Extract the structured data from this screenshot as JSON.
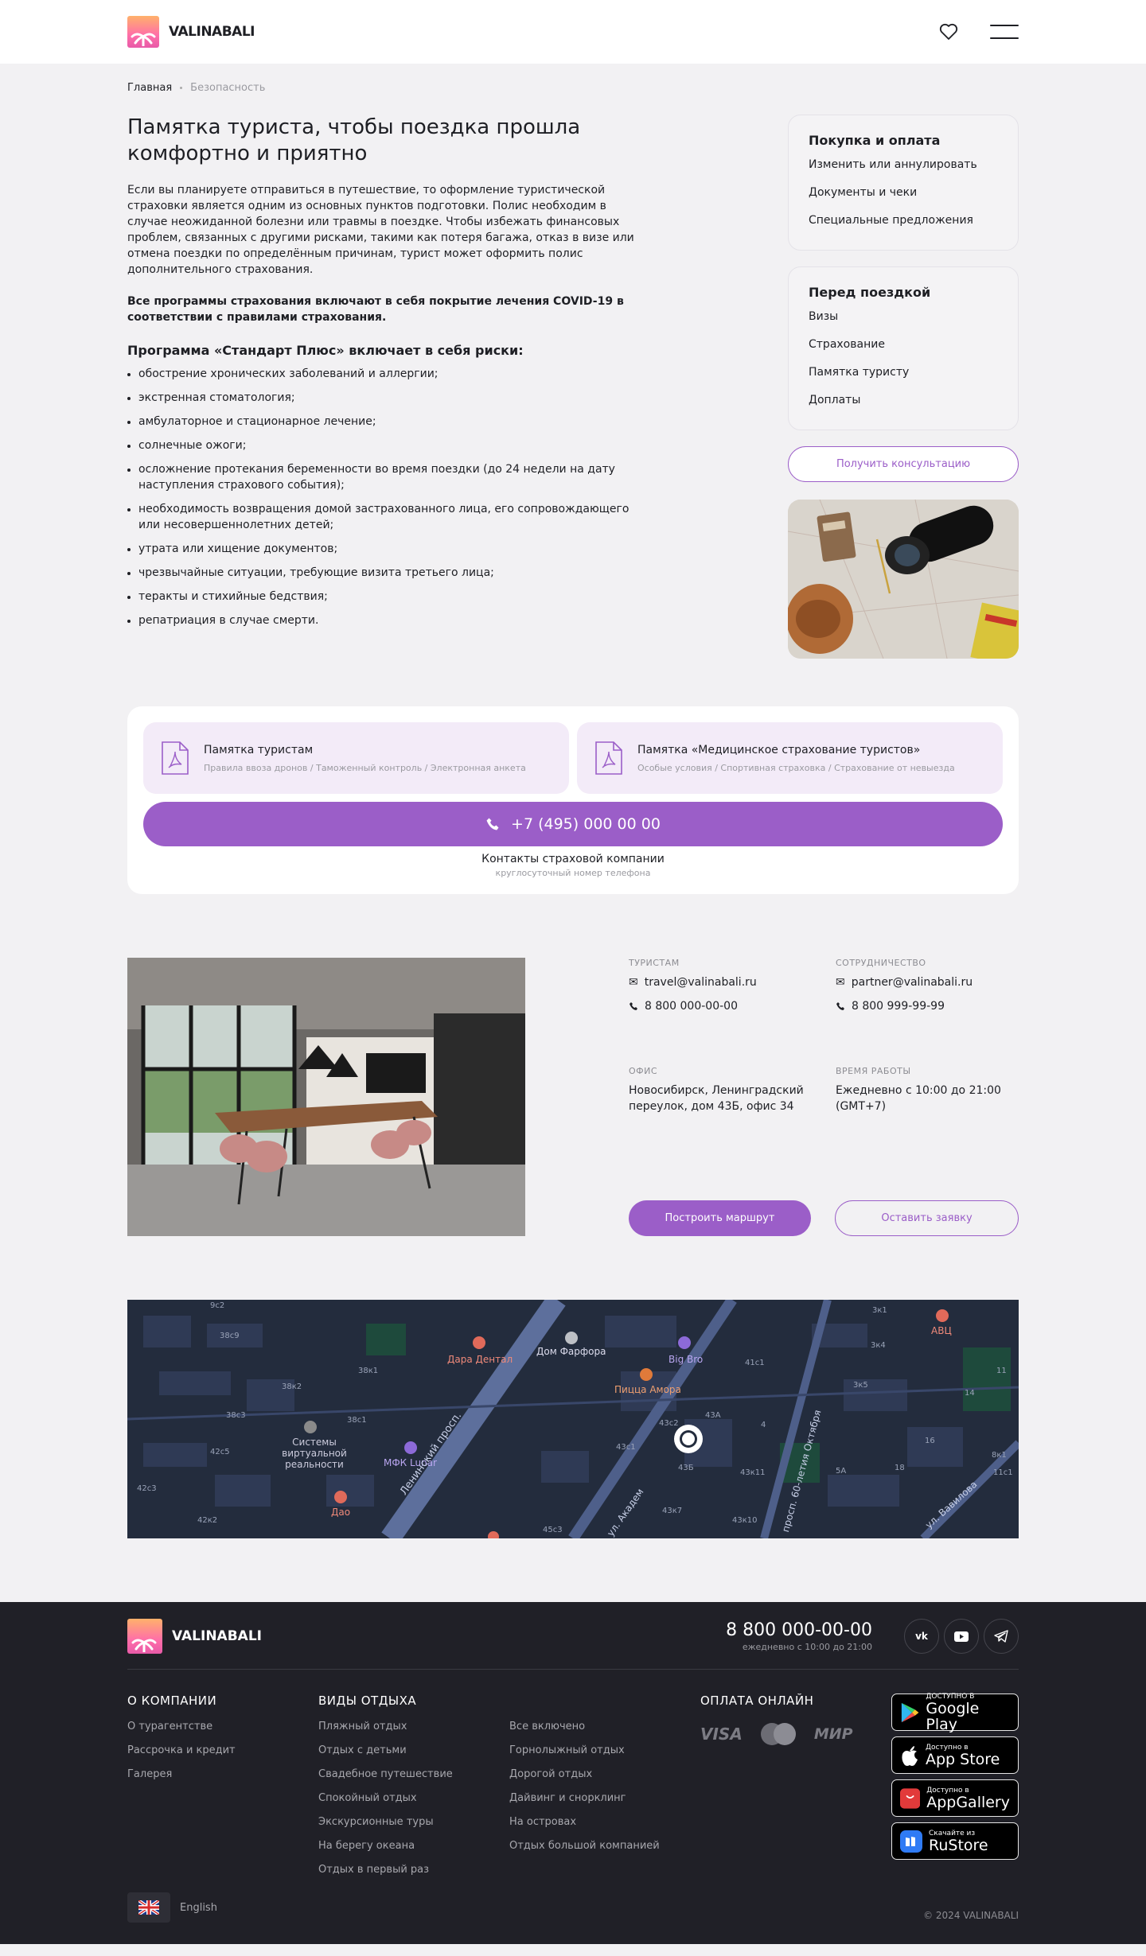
{
  "brand": {
    "name": "VALINABALI"
  },
  "breadcrumbs": [
    "Главная",
    "Безопасность"
  ],
  "article": {
    "title": "Памятка туриста, чтобы поездка прошла комфортно и приятно",
    "intro": "Если вы планируете отправиться в путешествие, то оформление туристической страховки является одним из основных пунктов подготовки. Полис необходим в случае неожиданной болезни или травмы в поездке. Чтобы избежать финансовых проблем, связанных с другими рисками, такими как потеря багажа, отказ в визе или отмена поездки по определённым причинам, турист может оформить полис дополнительного страхования.",
    "covid_note": "Все программы страхования включают в себя покрытие лечения COVID-19 в соответствии с правилами страхования.",
    "program_title": "Программа «Стандарт Плюс» включает в себя риски:",
    "risks": [
      "обострение хронических заболеваний и аллергии;",
      "экстренная стоматология;",
      "амбулаторное и стационарное лечение;",
      "солнечные ожоги;",
      "осложнение протекания беременности во время поездки (до 24 недели на дату наступления страхового события);",
      "необходимость возвращения домой застрахованного лица, его сопровождающего или несовершеннолетних детей;",
      "утрата или хищение документов;",
      "чрезвычайные ситуации, требующие визита третьего лица;",
      "теракты и стихийные бедствия;",
      "репатриация в случае смерти."
    ]
  },
  "sidebar": {
    "purchase": {
      "title": "Покупка и оплата",
      "items": [
        "Изменить или аннулировать",
        "Документы и чеки",
        "Специальные предложения"
      ]
    },
    "before_trip": {
      "title": "Перед поездкой",
      "items": [
        "Визы",
        "Страхование",
        "Памятка туристу",
        "Доплаты"
      ]
    },
    "consult_button": "Получить консультацию"
  },
  "docs": {
    "items": [
      {
        "title": "Памятка туристам",
        "subtitle": "Правила ввоза дронов / Таможенный контроль / Электронная анкета"
      },
      {
        "title": "Памятка «Медицинское страхование туристов»",
        "subtitle": "Особые условия / Спортивная страховка / Страхование от невыезда"
      }
    ],
    "phone": "+7 (495) 000 00 00",
    "contact_title": "Контакты страховой компании",
    "contact_sub": "круглосуточный номер телефона"
  },
  "contacts": {
    "tourists": {
      "label": "ТУРИСТАМ",
      "email": "travel@valinabali.ru",
      "phone": "8 800 000-00-00"
    },
    "partners": {
      "label": "СОТРУДНИЧЕСТВО",
      "email": "partner@valinabali.ru",
      "phone": "8 800 999-99-99"
    },
    "office": {
      "label": "ОФИС",
      "address": "Новосибирск, Ленинградский переулок, дом 43Б, офис 34"
    },
    "hours": {
      "label": "ВРЕМЯ РАБОТЫ",
      "value": "Ежедневно с 10:00 до 21:00 (GMT+7)"
    },
    "route_button": "Построить маршрут",
    "request_button": "Оставить заявку"
  },
  "map": {
    "labels": [
      "Дара Дентал",
      "Дом Фарфора",
      "Big Bro",
      "АВЦ",
      "Пицца Амора",
      "Системы виртуальной реальности",
      "МФК Lunar",
      "Дао",
      "Ленинский просп.",
      "ул. Академ",
      "просп. 60-летия Октября",
      "ул. Вавилова"
    ],
    "house_numbers": [
      "9с2",
      "38с9",
      "38к1",
      "38к2",
      "38с3",
      "38с1",
      "42с5",
      "42с3",
      "42к2",
      "45с3",
      "43с2",
      "43А",
      "43с1",
      "43Б",
      "43к7",
      "43к10",
      "43к11",
      "41с1",
      "3к1",
      "3к4",
      "3к5",
      "11",
      "14",
      "16",
      "18",
      "5А",
      "4",
      "8к1",
      "11с1"
    ]
  },
  "footer": {
    "phone": "8 800 000-00-00",
    "phone_hours": "ежедневно с 10:00 до 21:00",
    "about": {
      "title": "О КОМПАНИИ",
      "links": [
        "О турагентстве",
        "Рассрочка и кредит",
        "Галерея"
      ]
    },
    "rest": {
      "title": "ВИДЫ ОТДЫХА",
      "links_left": [
        "Пляжный отдых",
        "Отдых с детьми",
        "Свадебное путешествие",
        "Спокойный отдых",
        "Экскурсионные туры",
        "На берегу океана",
        "Отдых в первый раз"
      ],
      "links_right": [
        "Все включено",
        "Горнолыжный отдых",
        "Дорогой отдых",
        "Дайвинг и снорклинг",
        "На островах",
        "Отдых большой компанией"
      ]
    },
    "payment": {
      "title": "ОПЛАТА ОНЛАЙН",
      "methods": [
        "VISA",
        "МИР"
      ]
    },
    "stores": [
      {
        "small": "ДОСТУПНО В",
        "big": "Google Play"
      },
      {
        "small": "Доступно в",
        "big": "App Store"
      },
      {
        "small": "Доступно в",
        "big": "AppGallery"
      },
      {
        "small": "Скачайте из",
        "big": "RuStore"
      }
    ],
    "language": "English",
    "copyright": "© 2024 VALINABALI"
  },
  "colors": {
    "accent": "#9b5ec8",
    "footer_bg": "#202027",
    "page_bg": "#f2f1f3"
  }
}
